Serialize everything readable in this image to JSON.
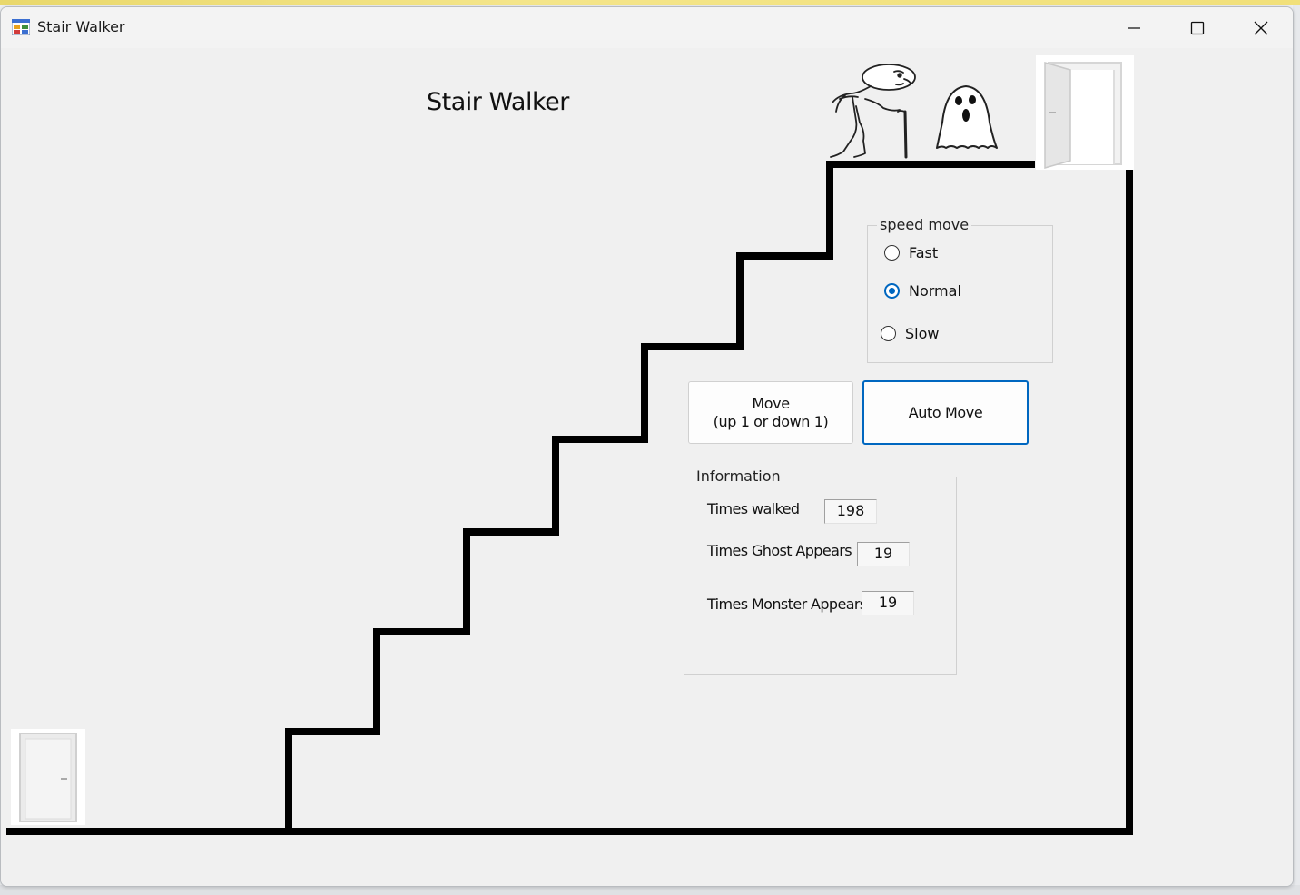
{
  "window": {
    "title": "Stair Walker",
    "controls": {
      "minimize": "minimize-icon",
      "maximize": "maximize-icon",
      "close": "close-icon"
    }
  },
  "form": {
    "heading": "Stair Walker"
  },
  "speed_group": {
    "caption": "speed move",
    "options": [
      {
        "label": "Fast",
        "checked": false
      },
      {
        "label": "Normal",
        "checked": true
      },
      {
        "label": "Slow",
        "checked": false
      }
    ],
    "selected": "Normal"
  },
  "buttons": {
    "move_line1": "Move",
    "move_line2": "(up 1 or down 1)",
    "auto_move": "Auto Move"
  },
  "info_group": {
    "caption": "Information",
    "times_walked_label": "Times walked",
    "times_walked_value": "198",
    "ghost_label": "Times Ghost Appears",
    "ghost_value": "19",
    "monster_label": "Times Monster Appears",
    "monster_value": "19"
  },
  "icons": {
    "app": "app-icon",
    "walker": "old-man-walker-icon",
    "ghost": "ghost-icon",
    "top_door": "open-door-icon",
    "bottom_door": "closed-door-icon"
  },
  "colors": {
    "accent": "#0067c0",
    "stairs": "#000000",
    "background": "#f0f0f0"
  }
}
